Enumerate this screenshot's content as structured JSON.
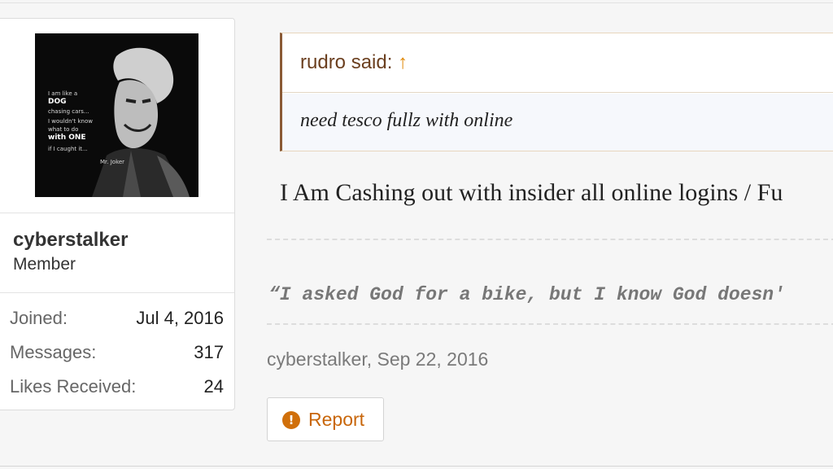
{
  "user": {
    "name": "cyberstalker",
    "title": "Member",
    "avatar_text": [
      "I am like a",
      "DOG",
      "chasing cars...",
      "I wouldn't know",
      "what to do",
      "with ONE",
      "if I caught it...",
      "Mr. Joker"
    ],
    "stats": [
      {
        "label": "Joined:",
        "value": "Jul 4, 2016"
      },
      {
        "label": "Messages:",
        "value": "317"
      },
      {
        "label": "Likes Received:",
        "value": "24"
      }
    ]
  },
  "quote": {
    "author": "rudro said:",
    "arrow": "↑",
    "text": "need tesco fullz with online"
  },
  "post": {
    "message": "I Am Cashing out with insider all online logins / Fu",
    "signature": "“I asked God for a bike, but I know God doesn'",
    "meta": "cyberstalker, Sep 22, 2016"
  },
  "actions": {
    "report_icon": "!",
    "report_label": "Report"
  },
  "colors": {
    "quote_author": "#6b3f1f",
    "quote_arrow": "#e08a0c",
    "report": "#c8660a",
    "quote_border": "#8a5a35"
  }
}
